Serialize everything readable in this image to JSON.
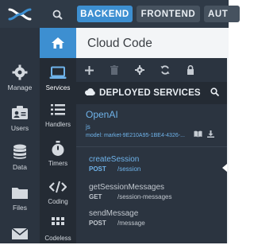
{
  "topbar": {
    "tabs": [
      "BACKEND",
      "FRONTEND",
      "AUT"
    ]
  },
  "nav": {
    "items": [
      {
        "label": "Manage",
        "icon": "gear-icon"
      },
      {
        "label": "Users",
        "icon": "users-icon"
      },
      {
        "label": "Data",
        "icon": "database-icon"
      },
      {
        "label": "Files",
        "icon": "folder-icon"
      },
      {
        "label": "",
        "icon": "mail-icon"
      }
    ]
  },
  "subnav": {
    "items": [
      {
        "label": "Services",
        "icon": "laptop-icon"
      },
      {
        "label": "Handlers",
        "icon": "list-icon"
      },
      {
        "label": "Timers",
        "icon": "stopwatch-icon"
      },
      {
        "label": "Coding",
        "icon": "code-icon"
      },
      {
        "label": "Codeless",
        "icon": "grid-icon"
      }
    ]
  },
  "content": {
    "title": "Cloud Code"
  },
  "panel": {
    "section_title": "DEPLOYED SERVICES",
    "service": {
      "name": "OpenAI",
      "lang": "js",
      "model": "model: market-9E210A95-1BE4-4326-..."
    },
    "methods": [
      {
        "name": "createSession",
        "verb": "POST",
        "path": "/session",
        "active": true
      },
      {
        "name": "getSessionMessages",
        "verb": "GET",
        "path": "/session-messages",
        "active": false
      },
      {
        "name": "sendMessage",
        "verb": "POST",
        "path": "/message",
        "active": false
      }
    ]
  },
  "colors": {
    "accent": "#3d8fd1",
    "link": "#6fb3ea",
    "sidebar": "#2b3440",
    "topbar": "#2f3a47"
  }
}
